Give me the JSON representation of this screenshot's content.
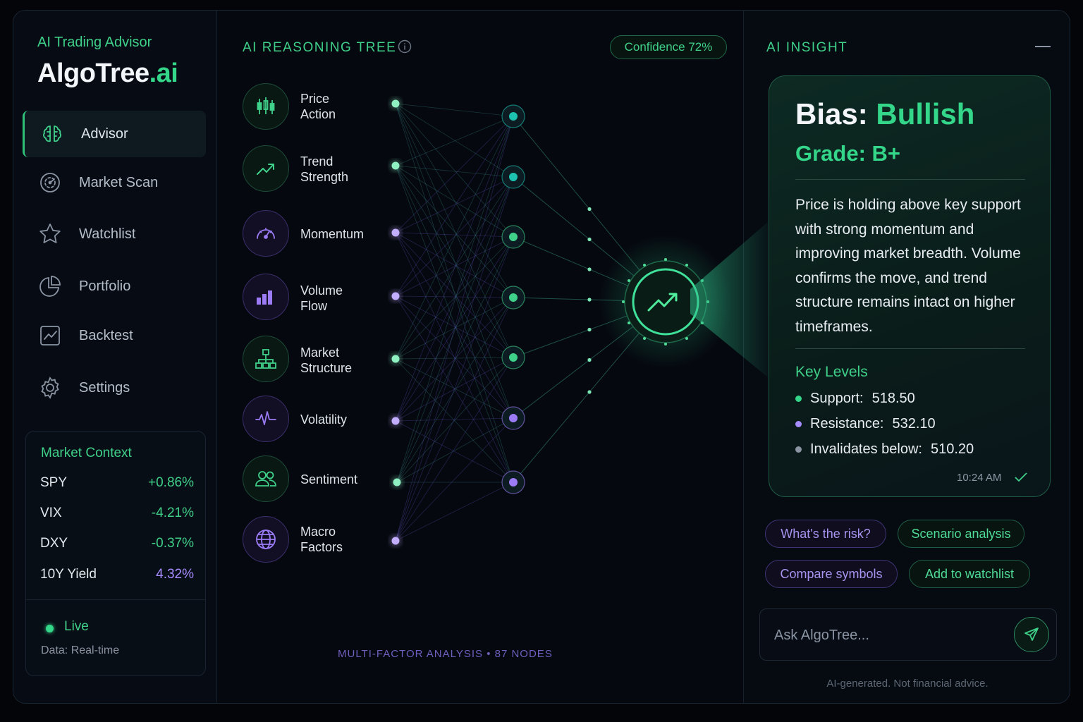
{
  "sidebar": {
    "subtitle": "AI Trading Advisor",
    "brand_main": "AlgoTree",
    "brand_suffix": ".ai",
    "nav": [
      {
        "label": "Advisor",
        "icon": "brain-icon",
        "active": true
      },
      {
        "label": "Market Scan",
        "icon": "radar-icon",
        "active": false
      },
      {
        "label": "Watchlist",
        "icon": "star-icon",
        "active": false
      },
      {
        "label": "Portfolio",
        "icon": "pie-chart-icon",
        "active": false
      },
      {
        "label": "Backtest",
        "icon": "line-chart-icon",
        "active": false
      },
      {
        "label": "Settings",
        "icon": "gear-icon",
        "active": false
      }
    ],
    "market_context": {
      "title": "Market Context",
      "rows": [
        {
          "symbol": "SPY",
          "change": "+0.86%",
          "color": "#3fd08a"
        },
        {
          "symbol": "VIX",
          "change": "-4.21%",
          "color": "#3fd08a"
        },
        {
          "symbol": "DXY",
          "change": "-0.37%",
          "color": "#3fd08a"
        },
        {
          "symbol": "10Y Yield",
          "change": "4.32%",
          "color": "#a68cff"
        }
      ],
      "status": "Live",
      "data_note": "Data: Real-time"
    }
  },
  "tree": {
    "title": "AI REASONING TREE",
    "confidence": "Confidence 72%",
    "factors": [
      {
        "label": "Price\nAction",
        "icon": "candlestick-icon",
        "tone": "green"
      },
      {
        "label": "Trend\nStrength",
        "icon": "trend-up-icon",
        "tone": "green"
      },
      {
        "label": "Momentum",
        "icon": "gauge-icon",
        "tone": "purple"
      },
      {
        "label": "Volume\nFlow",
        "icon": "bar-chart-icon",
        "tone": "purple"
      },
      {
        "label": "Market\nStructure",
        "icon": "hierarchy-icon",
        "tone": "green"
      },
      {
        "label": "Volatility",
        "icon": "pulse-icon",
        "tone": "purple"
      },
      {
        "label": "Sentiment",
        "icon": "users-icon",
        "tone": "green"
      },
      {
        "label": "Macro\nFactors",
        "icon": "globe-icon",
        "tone": "purple"
      }
    ],
    "footer": "MULTI-FACTOR ANALYSIS  •  87 NODES",
    "colors": {
      "green": "#3fd08a",
      "purple": "#9b7cf6",
      "teal": "#1ec2b0"
    }
  },
  "insight": {
    "title": "AI INSIGHT",
    "bias_label": "Bias:",
    "bias_value": "Bullish",
    "grade": "Grade: B+",
    "summary": "Price is holding above key support with strong momentum and improving market breadth. Volume confirms the move, and trend structure remains intact on higher timeframes.",
    "key_levels_title": "Key Levels",
    "levels": [
      {
        "label": "Support:",
        "value": "518.50",
        "color": "#34d68a"
      },
      {
        "label": "Resistance:",
        "value": "532.10",
        "color": "#a68cff"
      },
      {
        "label": "Invalidates below:",
        "value": "510.20",
        "color": "#8a94a2"
      }
    ],
    "timestamp": "10:24 AM",
    "chips": [
      {
        "label": "What's the risk?",
        "tone": "purple"
      },
      {
        "label": "Scenario analysis",
        "tone": "green"
      },
      {
        "label": "Compare symbols",
        "tone": "purple"
      },
      {
        "label": "Add to watchlist",
        "tone": "green"
      }
    ],
    "ask_placeholder": "Ask AlgoTree...",
    "disclaimer": "AI-generated. Not financial advice."
  }
}
